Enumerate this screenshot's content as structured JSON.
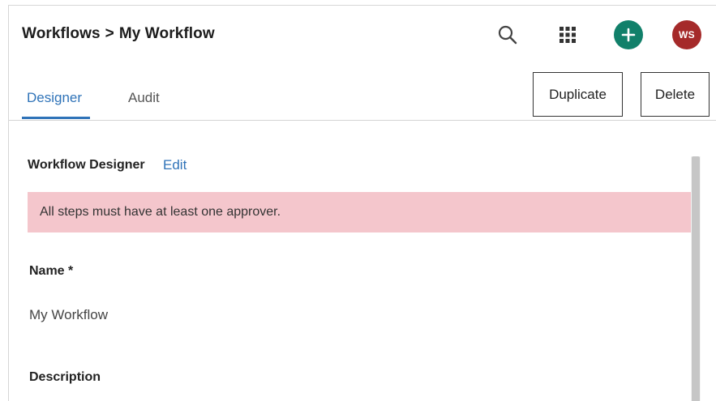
{
  "header": {
    "breadcrumb": {
      "root": "Workflows",
      "separator": ">",
      "current": "My Workflow"
    },
    "icons": {
      "search": "search-icon",
      "apps": "apps-grid-icon",
      "add": "plus-icon"
    },
    "avatar_initials": "WS"
  },
  "tabs": [
    {
      "label": "Designer",
      "active": true
    },
    {
      "label": "Audit",
      "active": false
    }
  ],
  "actions": {
    "duplicate_label": "Duplicate",
    "delete_label": "Delete"
  },
  "designer": {
    "title": "Workflow Designer",
    "edit_label": "Edit",
    "alert": "All steps must have at least one approver.",
    "name_label": "Name *",
    "name_value": "My Workflow",
    "description_label": "Description"
  },
  "colors": {
    "accent": "#2f73b8",
    "add_button": "#11806a",
    "avatar": "#a52a2a",
    "alert_bg": "#f4c6cc"
  }
}
